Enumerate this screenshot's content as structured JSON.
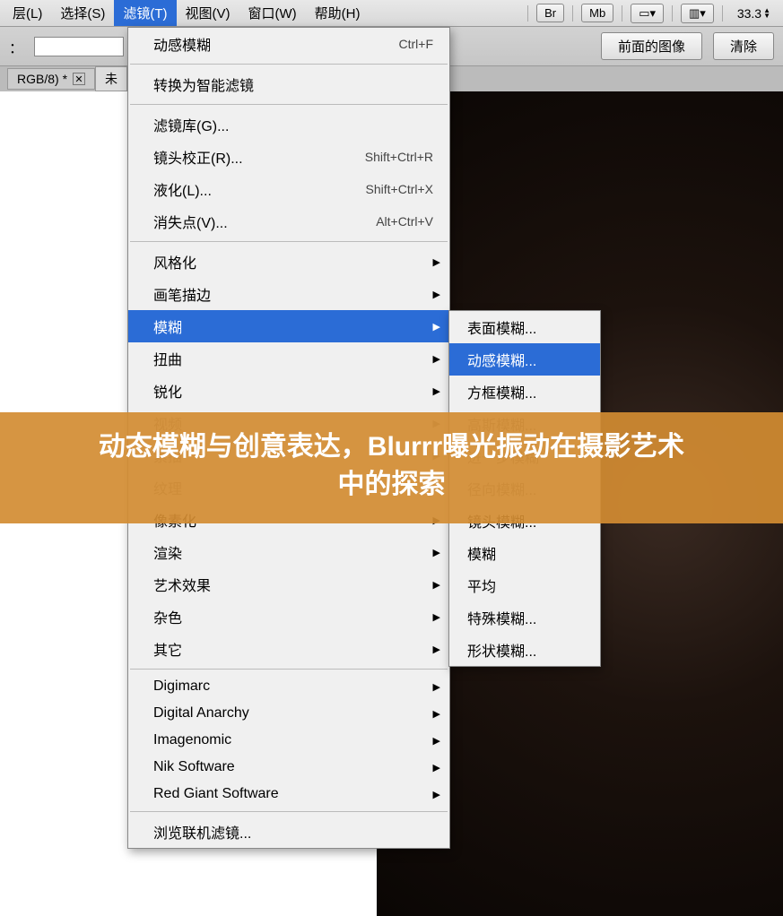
{
  "menubar": {
    "items": [
      "层(L)",
      "选择(S)",
      "滤镜(T)",
      "视图(V)",
      "窗口(W)",
      "帮助(H)"
    ],
    "active_index": 2,
    "tool_buttons": [
      "Br",
      "Mb"
    ],
    "zoom": "33.3"
  },
  "optbar": {
    "label": "：",
    "btn_front": "前面的图像",
    "btn_clear": "清除"
  },
  "doctab": {
    "tab1": "RGB/8) *",
    "tab2_stub": "未"
  },
  "dropdown": {
    "g0": [
      {
        "label": "动感模糊",
        "shortcut": "Ctrl+F"
      }
    ],
    "g1": [
      {
        "label": "转换为智能滤镜"
      }
    ],
    "g2": [
      {
        "label": "滤镜库(G)..."
      },
      {
        "label": "镜头校正(R)...",
        "shortcut": "Shift+Ctrl+R"
      },
      {
        "label": "液化(L)...",
        "shortcut": "Shift+Ctrl+X"
      },
      {
        "label": "消失点(V)...",
        "shortcut": "Alt+Ctrl+V"
      }
    ],
    "g3": [
      {
        "label": "风格化",
        "sub": true
      },
      {
        "label": "画笔描边",
        "sub": true
      },
      {
        "label": "模糊",
        "sub": true,
        "hover": true
      },
      {
        "label": "扭曲",
        "sub": true
      },
      {
        "label": "锐化",
        "sub": true
      },
      {
        "label": "视频",
        "sub": true,
        "dis": true
      },
      {
        "label": "素描",
        "sub": true,
        "dis": true
      },
      {
        "label": "纹理",
        "sub": true,
        "dis": true
      },
      {
        "label": "像素化",
        "sub": true
      },
      {
        "label": "渲染",
        "sub": true
      },
      {
        "label": "艺术效果",
        "sub": true
      },
      {
        "label": "杂色",
        "sub": true
      },
      {
        "label": "其它",
        "sub": true
      }
    ],
    "g4": [
      {
        "label": "Digimarc",
        "sub": true
      },
      {
        "label": "Digital Anarchy",
        "sub": true
      },
      {
        "label": "Imagenomic",
        "sub": true
      },
      {
        "label": "Nik Software",
        "sub": true
      },
      {
        "label": "Red Giant Software",
        "sub": true
      }
    ],
    "g5": [
      {
        "label": "浏览联机滤镜..."
      }
    ]
  },
  "submenu": [
    {
      "label": "表面模糊..."
    },
    {
      "label": "动感模糊...",
      "sel": true
    },
    {
      "label": "方框模糊..."
    },
    {
      "label": "高斯模糊...",
      "dis": true
    },
    {
      "label": "进一步模糊",
      "dis": true
    },
    {
      "label": "径向模糊...",
      "dis": true
    },
    {
      "label": "镜头模糊..."
    },
    {
      "label": "模糊"
    },
    {
      "label": "平均"
    },
    {
      "label": "特殊模糊..."
    },
    {
      "label": "形状模糊..."
    }
  ],
  "overlay": {
    "line1": "动态模糊与创意表达，Blurrr曝光振动在摄影艺术",
    "line2": "中的探索"
  }
}
